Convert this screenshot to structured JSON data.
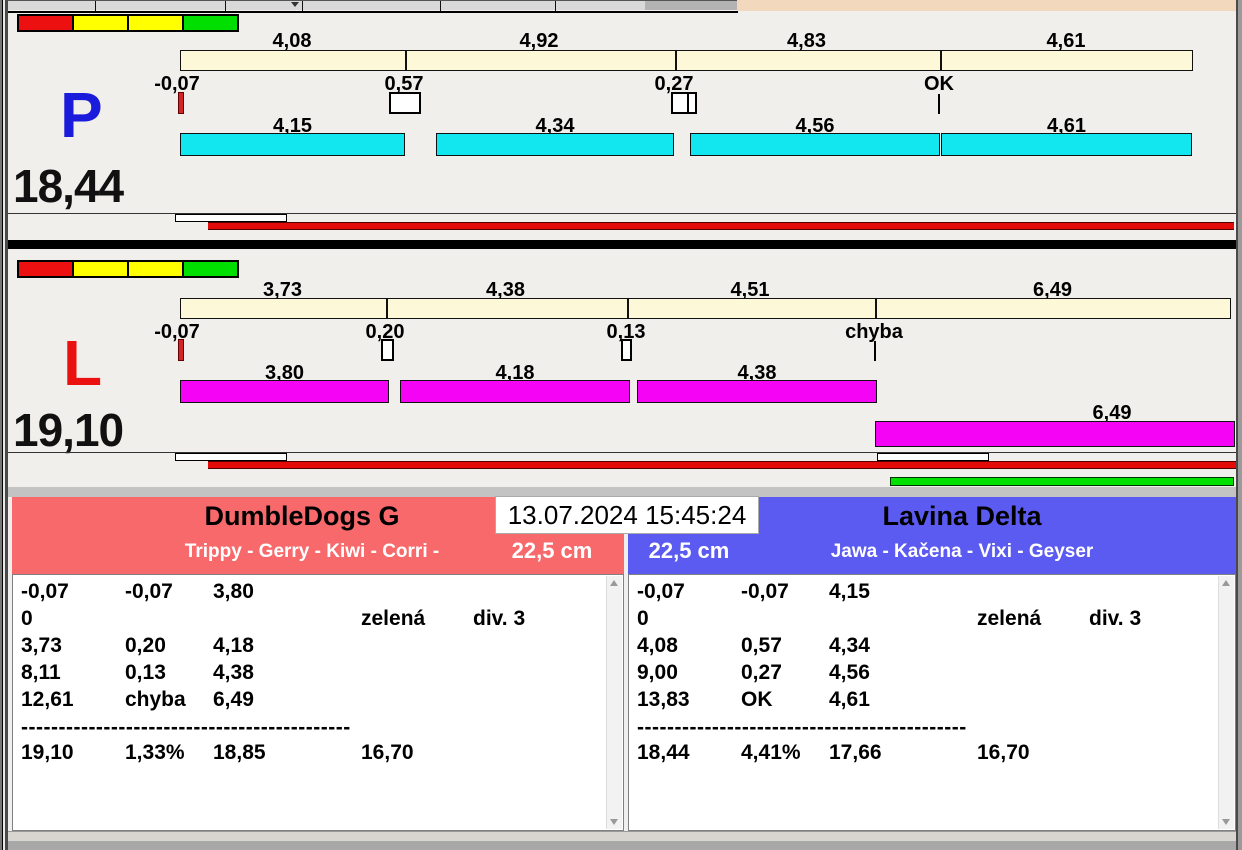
{
  "timestamp": "13.07.2024 15:45:24",
  "lanes": {
    "p": {
      "letter": "P",
      "total": "18,44",
      "splits": [
        "4,08",
        "4,92",
        "4,83",
        "4,61"
      ],
      "losses": [
        "-0,07",
        "0,57",
        "0,27",
        "OK"
      ],
      "dog_times": [
        "4,15",
        "4,34",
        "4,56",
        "4,61"
      ]
    },
    "l": {
      "letter": "L",
      "total": "19,10",
      "splits": [
        "3,73",
        "4,38",
        "4,51",
        "6,49"
      ],
      "losses": [
        "-0,07",
        "0,20",
        "0,13",
        "chyba"
      ],
      "dog_times": [
        "3,80",
        "4,18",
        "4,38",
        "6,49"
      ]
    }
  },
  "panels": {
    "left": {
      "team": "DumbleDogs G",
      "dogs": "Trippy - Gerry - Kiwi - Corri -",
      "jump_height": "22,5 cm",
      "rows": [
        {
          "c1": "-0,07",
          "c2": "-0,07",
          "c3": "3,80",
          "c4": "",
          "c5": ""
        },
        {
          "c1": "0",
          "c2": "",
          "c3": "",
          "c4": "zelená",
          "c5": "div. 3"
        },
        {
          "c1": "3,73",
          "c2": "0,20",
          "c3": "4,18",
          "c4": "",
          "c5": ""
        },
        {
          "c1": "8,11",
          "c2": "0,13",
          "c3": "4,38",
          "c4": "",
          "c5": ""
        },
        {
          "c1": "12,61",
          "c2": "chyba",
          "c3": "6,49",
          "c4": "",
          "c5": ""
        }
      ],
      "divider": "--------------------------------------------",
      "totals": {
        "time": "19,10",
        "pct": "1,33%",
        "net": "18,85",
        "ref": "16,70"
      }
    },
    "right": {
      "team": "Lavina Delta",
      "dogs": "Jawa - Kačena - Vixi - Geyser",
      "jump_height": "22,5 cm",
      "rows": [
        {
          "c1": "-0,07",
          "c2": "-0,07",
          "c3": "4,15",
          "c4": "",
          "c5": ""
        },
        {
          "c1": "0",
          "c2": "",
          "c3": "",
          "c4": "zelená",
          "c5": "div. 3"
        },
        {
          "c1": "4,08",
          "c2": "0,57",
          "c3": "4,34",
          "c4": "",
          "c5": ""
        },
        {
          "c1": "9,00",
          "c2": "0,27",
          "c3": "4,56",
          "c4": "",
          "c5": ""
        },
        {
          "c1": "13,83",
          "c2": "OK",
          "c3": "4,61",
          "c4": "",
          "c5": ""
        }
      ],
      "divider": "--------------------------------------------",
      "totals": {
        "time": "18,44",
        "pct": "4,41%",
        "net": "17,66",
        "ref": "16,70"
      }
    }
  },
  "colors": {
    "header_left_bg": "#f8696b",
    "header_right_bg": "#5b5bf2",
    "split_bar": "#fcf8d8",
    "dog_bar_p": "#12e7f0",
    "dog_bar_l": "#f503f5",
    "signal_red": "#ec1010",
    "signal_yellow": "#ffff00",
    "signal_green": "#00df00",
    "progress_red": "#e30a0a",
    "progress_green": "#00e000",
    "letter_p": "#1b1bdc",
    "letter_l": "#ec1111",
    "top_strip": "#f2d8bd"
  }
}
